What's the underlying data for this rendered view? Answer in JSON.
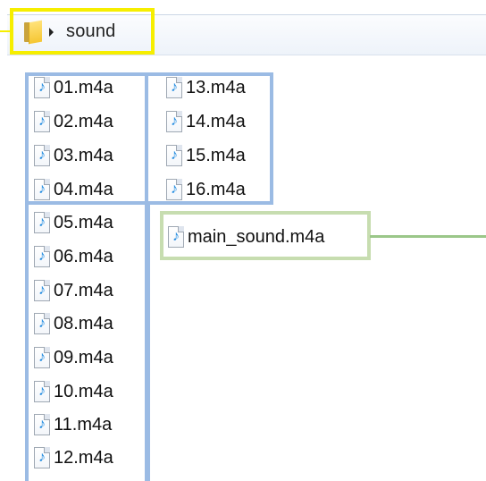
{
  "breadcrumb": {
    "label": "sound",
    "folder_icon": "folder-icon",
    "separator_icon": "chevron-right-icon"
  },
  "files": {
    "left": [
      "01.m4a",
      "02.m4a",
      "03.m4a",
      "04.m4a",
      "05.m4a",
      "06.m4a",
      "07.m4a",
      "08.m4a",
      "09.m4a",
      "10.m4a",
      "11.m4a",
      "12.m4a"
    ],
    "right": [
      "13.m4a",
      "14.m4a",
      "15.m4a",
      "16.m4a"
    ],
    "main": "main_sound.m4a"
  },
  "colors": {
    "breadcrumb_highlight": "#f6ee00",
    "file_group_highlight": "#9bbbe4",
    "main_file_highlight": "#c7ddb0",
    "main_file_callout": "#9bc789",
    "audio_note": "#1f8ae0"
  },
  "icons": {
    "audio_file": "audio-file-icon",
    "music_note": "music-note-icon"
  }
}
